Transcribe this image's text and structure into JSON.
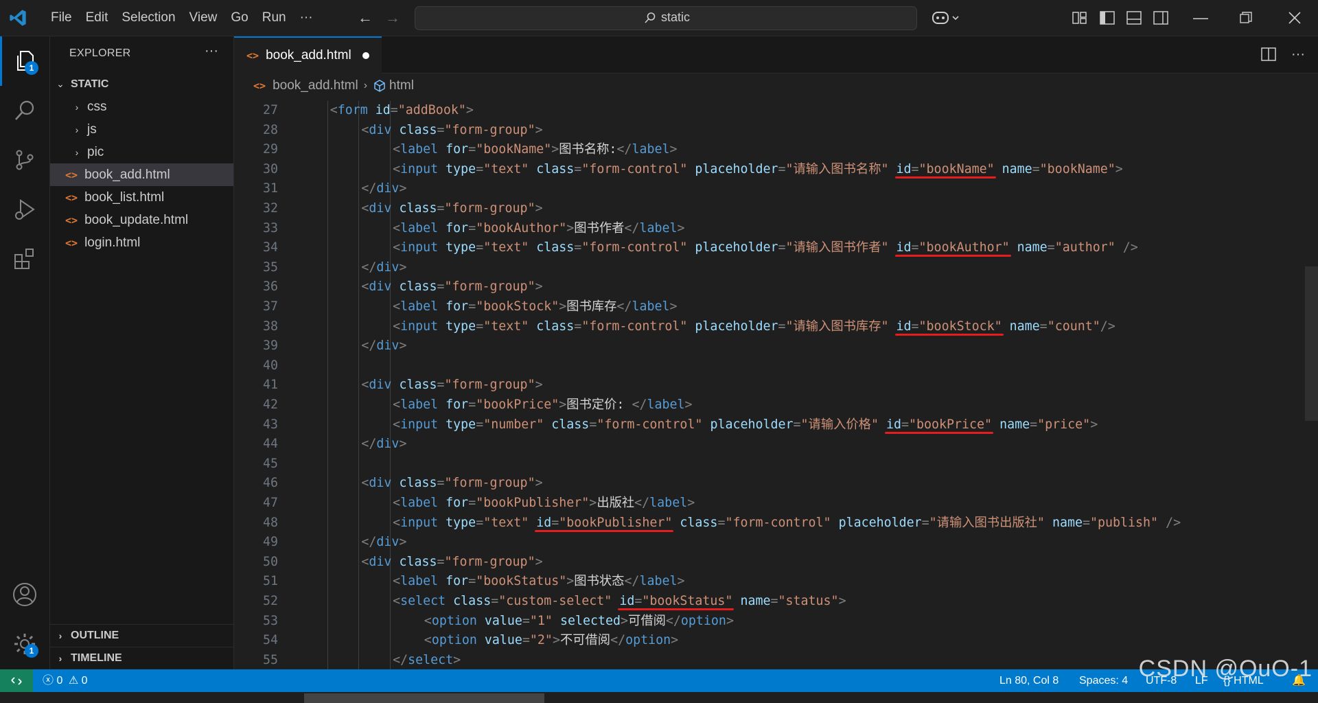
{
  "menu": [
    "File",
    "Edit",
    "Selection",
    "View",
    "Go",
    "Run",
    "···"
  ],
  "search": {
    "text": "static"
  },
  "explorer": {
    "title": "EXPLORER",
    "more": "···",
    "root": "STATIC",
    "folders": [
      "css",
      "js",
      "pic"
    ],
    "files": [
      "book_add.html",
      "book_list.html",
      "book_update.html",
      "login.html"
    ],
    "selected_file": "book_add.html",
    "outline": "OUTLINE",
    "timeline": "TIMELINE"
  },
  "activity": {
    "explorer_badge": "1",
    "settings_badge": "1"
  },
  "tab": {
    "label": "book_add.html",
    "file_icon": "<>"
  },
  "breadcrumb": {
    "file": "book_add.html",
    "symbol": "html"
  },
  "code_lines": [
    {
      "n": "27",
      "indent": 1,
      "tokens": [
        [
          "br",
          "<"
        ],
        [
          "tag",
          "form"
        ],
        [
          "sp",
          " "
        ],
        [
          "at",
          "id"
        ],
        [
          "br",
          "="
        ],
        [
          "str",
          "\"addBook\""
        ],
        [
          "br",
          ">"
        ]
      ]
    },
    {
      "n": "28",
      "indent": 2,
      "tokens": [
        [
          "br",
          "<"
        ],
        [
          "tag",
          "div"
        ],
        [
          "sp",
          " "
        ],
        [
          "at",
          "class"
        ],
        [
          "br",
          "="
        ],
        [
          "str",
          "\"form-group\""
        ],
        [
          "br",
          ">"
        ]
      ]
    },
    {
      "n": "29",
      "indent": 3,
      "tokens": [
        [
          "br",
          "<"
        ],
        [
          "tag",
          "label"
        ],
        [
          "sp",
          " "
        ],
        [
          "at",
          "for"
        ],
        [
          "br",
          "="
        ],
        [
          "str",
          "\"bookName\""
        ],
        [
          "br",
          ">"
        ],
        [
          "txt",
          "图书名称:"
        ],
        [
          "br",
          "</"
        ],
        [
          "tag",
          "label"
        ],
        [
          "br",
          ">"
        ]
      ]
    },
    {
      "n": "30",
      "indent": 3,
      "tokens": [
        [
          "br",
          "<"
        ],
        [
          "tag",
          "input"
        ],
        [
          "sp",
          " "
        ],
        [
          "at",
          "type"
        ],
        [
          "br",
          "="
        ],
        [
          "str",
          "\"text\""
        ],
        [
          "sp",
          " "
        ],
        [
          "at",
          "class"
        ],
        [
          "br",
          "="
        ],
        [
          "str",
          "\"form-control\""
        ],
        [
          "sp",
          " "
        ],
        [
          "at",
          "placeholder"
        ],
        [
          "br",
          "="
        ],
        [
          "str",
          "\"请输入图书名称\""
        ],
        [
          "sp",
          " "
        ],
        [
          "at",
          "id"
        ],
        [
          "br",
          "="
        ],
        [
          "str",
          "\"bookName\""
        ],
        [
          "sp",
          " "
        ],
        [
          "at",
          "name"
        ],
        [
          "br",
          "="
        ],
        [
          "str",
          "\"bookName\""
        ],
        [
          "br",
          ">"
        ]
      ]
    },
    {
      "n": "31",
      "indent": 2,
      "tokens": [
        [
          "br",
          "</"
        ],
        [
          "tag",
          "div"
        ],
        [
          "br",
          ">"
        ]
      ]
    },
    {
      "n": "32",
      "indent": 2,
      "tokens": [
        [
          "br",
          "<"
        ],
        [
          "tag",
          "div"
        ],
        [
          "sp",
          " "
        ],
        [
          "at",
          "class"
        ],
        [
          "br",
          "="
        ],
        [
          "str",
          "\"form-group\""
        ],
        [
          "br",
          ">"
        ]
      ]
    },
    {
      "n": "33",
      "indent": 3,
      "tokens": [
        [
          "br",
          "<"
        ],
        [
          "tag",
          "label"
        ],
        [
          "sp",
          " "
        ],
        [
          "at",
          "for"
        ],
        [
          "br",
          "="
        ],
        [
          "str",
          "\"bookAuthor\""
        ],
        [
          "br",
          ">"
        ],
        [
          "txt",
          "图书作者"
        ],
        [
          "br",
          "</"
        ],
        [
          "tag",
          "label"
        ],
        [
          "br",
          ">"
        ]
      ]
    },
    {
      "n": "34",
      "indent": 3,
      "tokens": [
        [
          "br",
          "<"
        ],
        [
          "tag",
          "input"
        ],
        [
          "sp",
          " "
        ],
        [
          "at",
          "type"
        ],
        [
          "br",
          "="
        ],
        [
          "str",
          "\"text\""
        ],
        [
          "sp",
          " "
        ],
        [
          "at",
          "class"
        ],
        [
          "br",
          "="
        ],
        [
          "str",
          "\"form-control\""
        ],
        [
          "sp",
          " "
        ],
        [
          "at",
          "placeholder"
        ],
        [
          "br",
          "="
        ],
        [
          "str",
          "\"请输入图书作者\""
        ],
        [
          "sp",
          " "
        ],
        [
          "at",
          "id"
        ],
        [
          "br",
          "="
        ],
        [
          "str",
          "\"bookAuthor\""
        ],
        [
          "sp",
          " "
        ],
        [
          "at",
          "name"
        ],
        [
          "br",
          "="
        ],
        [
          "str",
          "\"author\""
        ],
        [
          "sp",
          " "
        ],
        [
          "br",
          "/>"
        ]
      ]
    },
    {
      "n": "35",
      "indent": 2,
      "tokens": [
        [
          "br",
          "</"
        ],
        [
          "tag",
          "div"
        ],
        [
          "br",
          ">"
        ]
      ]
    },
    {
      "n": "36",
      "indent": 2,
      "tokens": [
        [
          "br",
          "<"
        ],
        [
          "tag",
          "div"
        ],
        [
          "sp",
          " "
        ],
        [
          "at",
          "class"
        ],
        [
          "br",
          "="
        ],
        [
          "str",
          "\"form-group\""
        ],
        [
          "br",
          ">"
        ]
      ]
    },
    {
      "n": "37",
      "indent": 3,
      "tokens": [
        [
          "br",
          "<"
        ],
        [
          "tag",
          "label"
        ],
        [
          "sp",
          " "
        ],
        [
          "at",
          "for"
        ],
        [
          "br",
          "="
        ],
        [
          "str",
          "\"bookStock\""
        ],
        [
          "br",
          ">"
        ],
        [
          "txt",
          "图书库存"
        ],
        [
          "br",
          "</"
        ],
        [
          "tag",
          "label"
        ],
        [
          "br",
          ">"
        ]
      ]
    },
    {
      "n": "38",
      "indent": 3,
      "tokens": [
        [
          "br",
          "<"
        ],
        [
          "tag",
          "input"
        ],
        [
          "sp",
          " "
        ],
        [
          "at",
          "type"
        ],
        [
          "br",
          "="
        ],
        [
          "str",
          "\"text\""
        ],
        [
          "sp",
          " "
        ],
        [
          "at",
          "class"
        ],
        [
          "br",
          "="
        ],
        [
          "str",
          "\"form-control\""
        ],
        [
          "sp",
          " "
        ],
        [
          "at",
          "placeholder"
        ],
        [
          "br",
          "="
        ],
        [
          "str",
          "\"请输入图书库存\""
        ],
        [
          "sp",
          " "
        ],
        [
          "at",
          "id"
        ],
        [
          "br",
          "="
        ],
        [
          "str",
          "\"bookStock\""
        ],
        [
          "sp",
          " "
        ],
        [
          "at",
          "name"
        ],
        [
          "br",
          "="
        ],
        [
          "str",
          "\"count\""
        ],
        [
          "br",
          "/>"
        ]
      ]
    },
    {
      "n": "39",
      "indent": 2,
      "tokens": [
        [
          "br",
          "</"
        ],
        [
          "tag",
          "div"
        ],
        [
          "br",
          ">"
        ]
      ]
    },
    {
      "n": "40",
      "indent": 0,
      "tokens": []
    },
    {
      "n": "41",
      "indent": 2,
      "tokens": [
        [
          "br",
          "<"
        ],
        [
          "tag",
          "div"
        ],
        [
          "sp",
          " "
        ],
        [
          "at",
          "class"
        ],
        [
          "br",
          "="
        ],
        [
          "str",
          "\"form-group\""
        ],
        [
          "br",
          ">"
        ]
      ]
    },
    {
      "n": "42",
      "indent": 3,
      "tokens": [
        [
          "br",
          "<"
        ],
        [
          "tag",
          "label"
        ],
        [
          "sp",
          " "
        ],
        [
          "at",
          "for"
        ],
        [
          "br",
          "="
        ],
        [
          "str",
          "\"bookPrice\""
        ],
        [
          "br",
          ">"
        ],
        [
          "txt",
          "图书定价: "
        ],
        [
          "br",
          "</"
        ],
        [
          "tag",
          "label"
        ],
        [
          "br",
          ">"
        ]
      ]
    },
    {
      "n": "43",
      "indent": 3,
      "tokens": [
        [
          "br",
          "<"
        ],
        [
          "tag",
          "input"
        ],
        [
          "sp",
          " "
        ],
        [
          "at",
          "type"
        ],
        [
          "br",
          "="
        ],
        [
          "str",
          "\"number\""
        ],
        [
          "sp",
          " "
        ],
        [
          "at",
          "class"
        ],
        [
          "br",
          "="
        ],
        [
          "str",
          "\"form-control\""
        ],
        [
          "sp",
          " "
        ],
        [
          "at",
          "placeholder"
        ],
        [
          "br",
          "="
        ],
        [
          "str",
          "\"请输入价格\""
        ],
        [
          "sp",
          " "
        ],
        [
          "at",
          "id"
        ],
        [
          "br",
          "="
        ],
        [
          "str",
          "\"bookPrice\""
        ],
        [
          "sp",
          " "
        ],
        [
          "at",
          "name"
        ],
        [
          "br",
          "="
        ],
        [
          "str",
          "\"price\""
        ],
        [
          "br",
          ">"
        ]
      ]
    },
    {
      "n": "44",
      "indent": 2,
      "tokens": [
        [
          "br",
          "</"
        ],
        [
          "tag",
          "div"
        ],
        [
          "br",
          ">"
        ]
      ]
    },
    {
      "n": "45",
      "indent": 0,
      "tokens": []
    },
    {
      "n": "46",
      "indent": 2,
      "tokens": [
        [
          "br",
          "<"
        ],
        [
          "tag",
          "div"
        ],
        [
          "sp",
          " "
        ],
        [
          "at",
          "class"
        ],
        [
          "br",
          "="
        ],
        [
          "str",
          "\"form-group\""
        ],
        [
          "br",
          ">"
        ]
      ]
    },
    {
      "n": "47",
      "indent": 3,
      "tokens": [
        [
          "br",
          "<"
        ],
        [
          "tag",
          "label"
        ],
        [
          "sp",
          " "
        ],
        [
          "at",
          "for"
        ],
        [
          "br",
          "="
        ],
        [
          "str",
          "\"bookPublisher\""
        ],
        [
          "br",
          ">"
        ],
        [
          "txt",
          "出版社"
        ],
        [
          "br",
          "</"
        ],
        [
          "tag",
          "label"
        ],
        [
          "br",
          ">"
        ]
      ]
    },
    {
      "n": "48",
      "indent": 3,
      "tokens": [
        [
          "br",
          "<"
        ],
        [
          "tag",
          "input"
        ],
        [
          "sp",
          " "
        ],
        [
          "at",
          "type"
        ],
        [
          "br",
          "="
        ],
        [
          "str",
          "\"text\""
        ],
        [
          "sp",
          " "
        ],
        [
          "at",
          "id"
        ],
        [
          "br",
          "="
        ],
        [
          "str",
          "\"bookPublisher\""
        ],
        [
          "sp",
          " "
        ],
        [
          "at",
          "class"
        ],
        [
          "br",
          "="
        ],
        [
          "str",
          "\"form-control\""
        ],
        [
          "sp",
          " "
        ],
        [
          "at",
          "placeholder"
        ],
        [
          "br",
          "="
        ],
        [
          "str",
          "\"请输入图书出版社\""
        ],
        [
          "sp",
          " "
        ],
        [
          "at",
          "name"
        ],
        [
          "br",
          "="
        ],
        [
          "str",
          "\"publish\""
        ],
        [
          "sp",
          " "
        ],
        [
          "br",
          "/>"
        ]
      ]
    },
    {
      "n": "49",
      "indent": 2,
      "tokens": [
        [
          "br",
          "</"
        ],
        [
          "tag",
          "div"
        ],
        [
          "br",
          ">"
        ]
      ]
    },
    {
      "n": "50",
      "indent": 2,
      "tokens": [
        [
          "br",
          "<"
        ],
        [
          "tag",
          "div"
        ],
        [
          "sp",
          " "
        ],
        [
          "at",
          "class"
        ],
        [
          "br",
          "="
        ],
        [
          "str",
          "\"form-group\""
        ],
        [
          "br",
          ">"
        ]
      ]
    },
    {
      "n": "51",
      "indent": 3,
      "tokens": [
        [
          "br",
          "<"
        ],
        [
          "tag",
          "label"
        ],
        [
          "sp",
          " "
        ],
        [
          "at",
          "for"
        ],
        [
          "br",
          "="
        ],
        [
          "str",
          "\"bookStatus\""
        ],
        [
          "br",
          ">"
        ],
        [
          "txt",
          "图书状态"
        ],
        [
          "br",
          "</"
        ],
        [
          "tag",
          "label"
        ],
        [
          "br",
          ">"
        ]
      ]
    },
    {
      "n": "52",
      "indent": 3,
      "tokens": [
        [
          "br",
          "<"
        ],
        [
          "tag",
          "select"
        ],
        [
          "sp",
          " "
        ],
        [
          "at",
          "class"
        ],
        [
          "br",
          "="
        ],
        [
          "str",
          "\"custom-select\""
        ],
        [
          "sp",
          " "
        ],
        [
          "at",
          "id"
        ],
        [
          "br",
          "="
        ],
        [
          "str",
          "\"bookStatus\""
        ],
        [
          "sp",
          " "
        ],
        [
          "at",
          "name"
        ],
        [
          "br",
          "="
        ],
        [
          "str",
          "\"status\""
        ],
        [
          "br",
          ">"
        ]
      ]
    },
    {
      "n": "53",
      "indent": 4,
      "tokens": [
        [
          "br",
          "<"
        ],
        [
          "tag",
          "option"
        ],
        [
          "sp",
          " "
        ],
        [
          "at",
          "value"
        ],
        [
          "br",
          "="
        ],
        [
          "str",
          "\"1\""
        ],
        [
          "sp",
          " "
        ],
        [
          "at",
          "selected"
        ],
        [
          "br",
          ">"
        ],
        [
          "txt",
          "可借阅"
        ],
        [
          "br",
          "</"
        ],
        [
          "tag",
          "option"
        ],
        [
          "br",
          ">"
        ]
      ]
    },
    {
      "n": "54",
      "indent": 4,
      "tokens": [
        [
          "br",
          "<"
        ],
        [
          "tag",
          "option"
        ],
        [
          "sp",
          " "
        ],
        [
          "at",
          "value"
        ],
        [
          "br",
          "="
        ],
        [
          "str",
          "\"2\""
        ],
        [
          "br",
          ">"
        ],
        [
          "txt",
          "不可借阅"
        ],
        [
          "br",
          "</"
        ],
        [
          "tag",
          "option"
        ],
        [
          "br",
          ">"
        ]
      ]
    },
    {
      "n": "55",
      "indent": 3,
      "tokens": [
        [
          "br",
          "</"
        ],
        [
          "tag",
          "select"
        ],
        [
          "br",
          ">"
        ]
      ]
    }
  ],
  "status": {
    "errors": "0",
    "warnings": "0",
    "position": "Ln 80, Col 8",
    "spaces": "Spaces: 4",
    "encoding": "UTF-8",
    "eol": "LF",
    "language": "HTML"
  },
  "watermark": "CSDN @OuO-1",
  "colors": {
    "accent": "#0078d4",
    "statusbar": "#007acc",
    "underline": "#e51d1d"
  }
}
